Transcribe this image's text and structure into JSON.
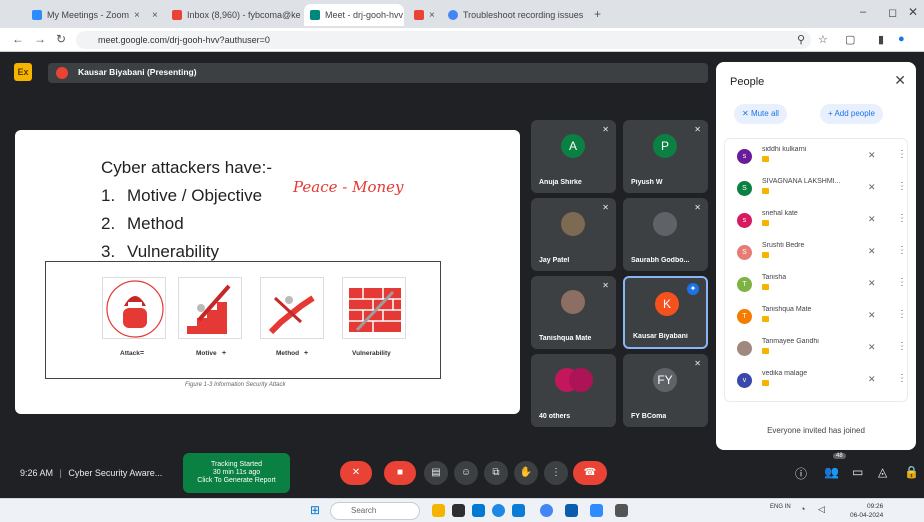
{
  "browser": {
    "tabs": [
      {
        "label": "My Meetings - Zoom",
        "color": "#2d8cff"
      },
      {
        "label": "",
        "color": "#999999"
      },
      {
        "label": "Inbox (8,960) - fybcoma@kes...",
        "color": "#ea4335"
      },
      {
        "label": "Meet - drj-gooh-hvv",
        "color": "#00897b"
      },
      {
        "label": "",
        "color": "#ea4335"
      },
      {
        "label": "Troubleshoot recording issues",
        "color": "#4285f4"
      }
    ],
    "url": "meet.google.com/drj-gooh-hvv?authuser=0",
    "new_tab_glyph": "+"
  },
  "meet_header": {
    "presenting": "Kausar Biyabani (Presenting)",
    "logo": "Ex"
  },
  "slide": {
    "title": "Cyber attackers have:-",
    "items": [
      {
        "num": "1.",
        "text": "Motive / Objective"
      },
      {
        "num": "2.",
        "text": "Method"
      },
      {
        "num": "3.",
        "text": "Vulnerability"
      }
    ],
    "handwriting": "Peace - Money",
    "figure": {
      "labels": [
        "Attack",
        "Motive",
        "Method",
        "Vulnerability"
      ],
      "ops": [
        "=",
        "+",
        "+"
      ],
      "caption": "Figure 1-3 Information Security Attack"
    }
  },
  "tiles": [
    {
      "name": "Anuja Shirke",
      "initial": "A",
      "color": "#0b8043"
    },
    {
      "name": "Piyush W",
      "initial": "P",
      "color": "#0b8043"
    },
    {
      "name": "Jay Patel",
      "initial": "",
      "color": "#7c6a52"
    },
    {
      "name": "Saurabh Godbo...",
      "initial": "",
      "color": "#5f6368"
    },
    {
      "name": "Tanishqua Mate",
      "initial": "",
      "color": "#8d6e63"
    },
    {
      "name": "Kausar Biyabani",
      "initial": "K",
      "color": "#f4511e"
    },
    {
      "name": "40 others",
      "initial": "",
      "color": "#c2185b"
    },
    {
      "name": "FY BComa",
      "initial": "FY",
      "color": "#5f6368"
    }
  ],
  "people_panel": {
    "title": "People",
    "mute_all": "Mute all",
    "add_people": "Add people",
    "people": [
      {
        "name": "siddhi kulkarni",
        "initial": "s",
        "color": "#6a1b9a"
      },
      {
        "name": "SIVAGNANA LAKSHMI...",
        "initial": "S",
        "color": "#0b8043"
      },
      {
        "name": "snehal kate",
        "initial": "s",
        "color": "#d81b60"
      },
      {
        "name": "Srushti Bedre",
        "initial": "S",
        "color": "#e67c73"
      },
      {
        "name": "Tanisha",
        "initial": "T",
        "color": "#7cb342"
      },
      {
        "name": "Tanishqua Mate",
        "initial": "T",
        "color": "#f57c00"
      },
      {
        "name": "Tanmayee Gandhi",
        "initial": "",
        "color": "#a1887f"
      },
      {
        "name": "vedika malage",
        "initial": "v",
        "color": "#3949ab"
      }
    ],
    "footer": "Everyone invited has joined"
  },
  "controls": {
    "time": "9:26 AM",
    "meeting": "Cyber Security Aware...",
    "tracking": [
      "Tracking Started",
      "30 min 11s ago",
      "Click To Generate Report"
    ],
    "participants_count": "48"
  },
  "taskbar": {
    "search": "Search",
    "time": "09:26",
    "date": "06-04-2024",
    "lang": "ENG IN"
  }
}
